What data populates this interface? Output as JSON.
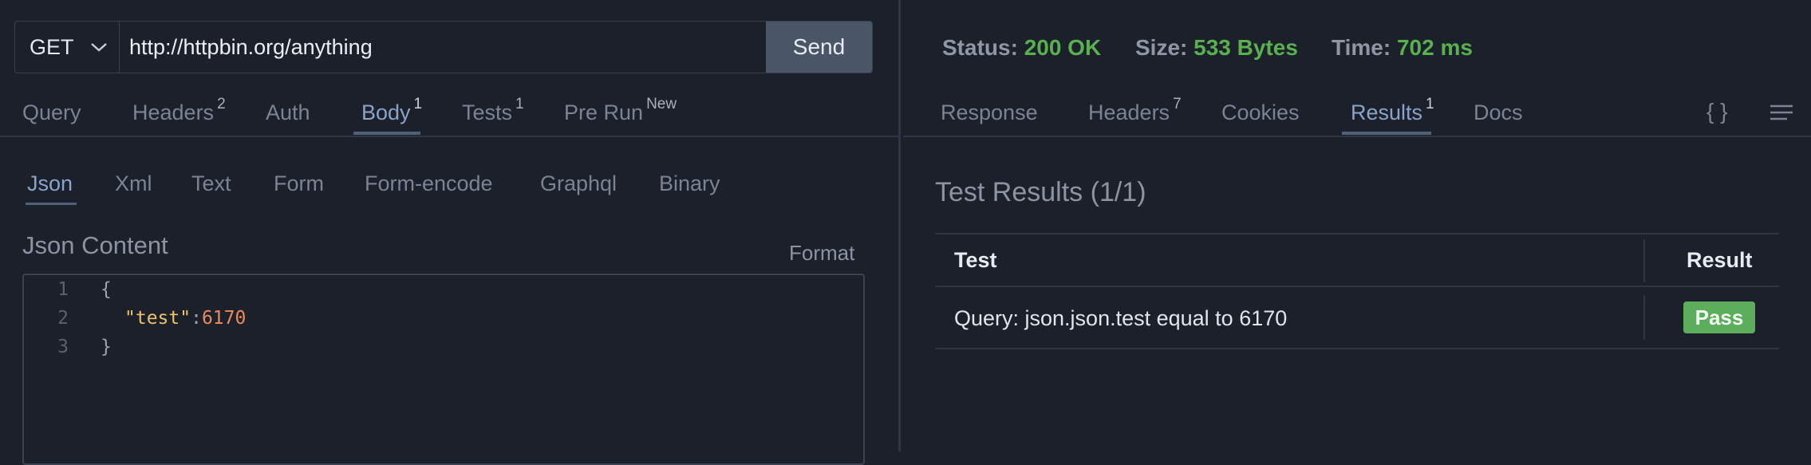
{
  "request": {
    "method": "GET",
    "url": "http://httpbin.org/anything",
    "send_label": "Send",
    "tabs": [
      {
        "label": "Query",
        "badge": ""
      },
      {
        "label": "Headers",
        "badge": "2"
      },
      {
        "label": "Auth",
        "badge": ""
      },
      {
        "label": "Body",
        "badge": "1"
      },
      {
        "label": "Tests",
        "badge": "1"
      },
      {
        "label": "Pre Run",
        "badge": "New"
      }
    ],
    "active_tab": "Body",
    "body_types": [
      "Json",
      "Xml",
      "Text",
      "Form",
      "Form-encode",
      "Graphql",
      "Binary"
    ],
    "active_body_type": "Json",
    "content_title": "Json Content",
    "format_label": "Format",
    "code_lines": [
      {
        "n": "1",
        "text": "{"
      },
      {
        "n": "2",
        "key": "\"test\"",
        "colon": ":",
        "value": "6170"
      },
      {
        "n": "3",
        "text": "}"
      }
    ]
  },
  "response": {
    "status_label": "Status:",
    "status_value": "200 OK",
    "size_label": "Size:",
    "size_value": "533 Bytes",
    "time_label": "Time:",
    "time_value": "702 ms",
    "tabs": [
      {
        "label": "Response",
        "badge": ""
      },
      {
        "label": "Headers",
        "badge": "7"
      },
      {
        "label": "Cookies",
        "badge": ""
      },
      {
        "label": "Results",
        "badge": "1"
      },
      {
        "label": "Docs",
        "badge": ""
      }
    ],
    "active_tab": "Results",
    "braces_icon": "{ }",
    "results_title": "Test Results (1/1)",
    "table": {
      "headers": [
        "Test",
        "Result"
      ],
      "rows": [
        {
          "test": "Query: json.json.test equal to 6170",
          "result": "Pass"
        }
      ]
    }
  },
  "colors": {
    "background": "#1b202b",
    "accent": "#8aa3c9",
    "success": "#59b04f",
    "pass_badge": "#5cae5c",
    "number": "#e98b5a",
    "string": "#e9c46a"
  }
}
